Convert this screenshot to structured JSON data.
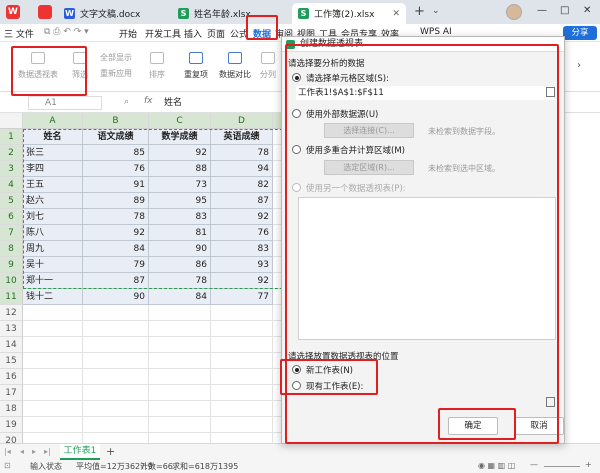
{
  "tabs": [
    {
      "label": "文字文稿.docx",
      "icon": "W",
      "color": "#2b5fd9"
    },
    {
      "label": "姓名年龄.xlsx",
      "icon": "S",
      "color": "#1e9e5a"
    },
    {
      "label": "工作簿(2).xlsx",
      "icon": "S",
      "color": "#1e9e5a"
    }
  ],
  "menu": [
    "开始",
    "插入",
    "页面",
    "公式",
    "数据",
    "审阅",
    "视图",
    "工具",
    "会员专享",
    "效率"
  ],
  "menu_left": {
    "file": "三 文件",
    "dev": "开发工具"
  },
  "menu_right": {
    "wps_ai": "WPS AI",
    "share": "分享"
  },
  "ribbon": {
    "pivot": "数据透视表",
    "filter": "筛选",
    "show_all": "全部显示",
    "reapply": "重新应用",
    "sort": "排序",
    "duplicates": "重复项",
    "compare": "数据对比",
    "split": "分列"
  },
  "formula": {
    "cell_ref": "A1",
    "fx": "fx",
    "value": "姓名"
  },
  "grid": {
    "columns": [
      "A",
      "B",
      "C",
      "D",
      "E"
    ],
    "rows": [
      "1",
      "2",
      "3",
      "4",
      "5",
      "6",
      "7",
      "8",
      "9",
      "10",
      "11",
      "12",
      "13",
      "14",
      "15",
      "16",
      "17",
      "18",
      "19",
      "20"
    ],
    "headers": [
      "姓名",
      "语文成绩",
      "数学成绩",
      "英语成绩"
    ],
    "data": [
      [
        "张三",
        "85",
        "92",
        "78"
      ],
      [
        "李四",
        "76",
        "88",
        "94"
      ],
      [
        "王五",
        "91",
        "73",
        "82"
      ],
      [
        "赵六",
        "89",
        "95",
        "87"
      ],
      [
        "刘七",
        "78",
        "83",
        "92"
      ],
      [
        "陈八",
        "92",
        "81",
        "76"
      ],
      [
        "周九",
        "84",
        "90",
        "83"
      ],
      [
        "吴十",
        "79",
        "86",
        "93"
      ],
      [
        "郑十一",
        "87",
        "78",
        "92"
      ],
      [
        "钱十二",
        "90",
        "84",
        "77"
      ]
    ]
  },
  "sheet": {
    "name": "工作表1",
    "add": "+"
  },
  "status": {
    "mode": "输入状态",
    "avg": "平均值=12万3627.9",
    "count": "计数=66",
    "sum": "求和=618万1395"
  },
  "dialog": {
    "title": "创建数据透视表",
    "section1": "请选择要分析的数据",
    "opt_range": "请选择单元格区域(S):",
    "range_value": "工作表1!$A$1:$F$11",
    "opt_external": "使用外部数据源(U)",
    "choose_conn": "选择连接(C)...",
    "no_field": "未检索到数据字段。",
    "opt_multi": "使用多重合并计算区域(M)",
    "choose_area": "选定区域(R)...",
    "no_area": "未检索到选中区域。",
    "opt_other": "使用另一个数据透视表(P):",
    "section2": "请选择放置数据透视表的位置",
    "new_sheet": "新工作表(N)",
    "existing_sheet": "现有工作表(E):",
    "ok": "确定",
    "cancel": "取消"
  }
}
